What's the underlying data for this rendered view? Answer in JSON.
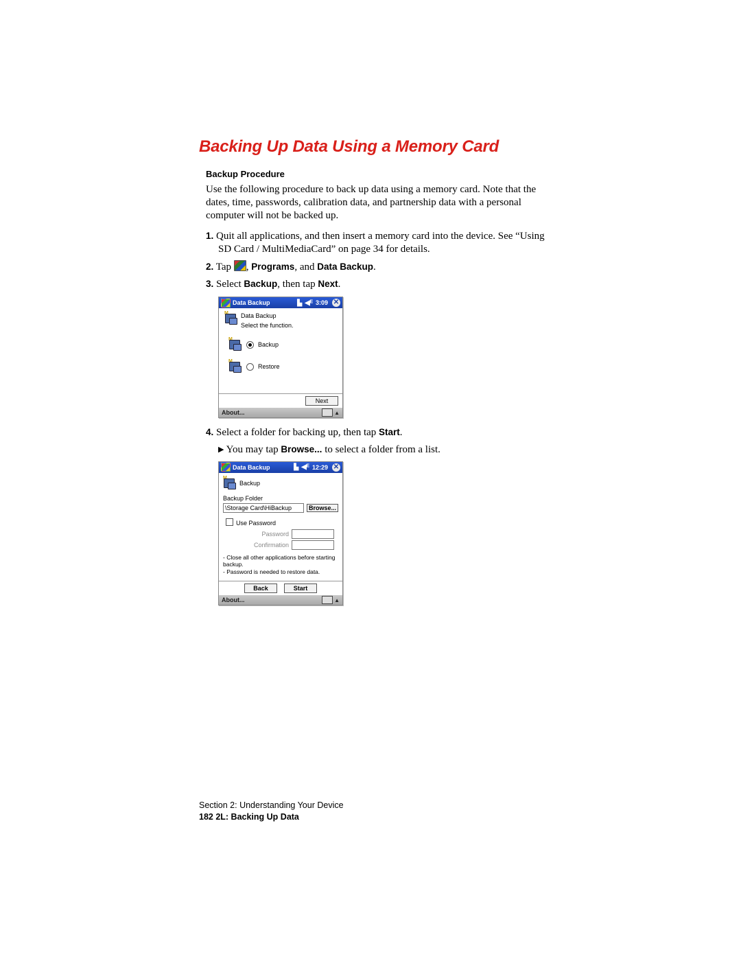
{
  "title": "Backing Up Data Using a Memory Card",
  "sub": "Backup Procedure",
  "intro": "Use the following procedure to back up data using a memory card. Note that the dates, time, passwords, calibration data, and partnership data with a personal computer will not be backed up.",
  "steps": {
    "s1": {
      "num": "1.",
      "a": "Quit all applications, and then insert a memory card into the device. See “Using SD Card / MultiMediaCard” on page 34 for details."
    },
    "s2": {
      "num": "2.",
      "a": "Tap ",
      "b": ", ",
      "c": "Programs",
      "d": ", and ",
      "e": "Data Backup",
      "f": "."
    },
    "s3": {
      "num": "3.",
      "a": "Select ",
      "b": "Backup",
      "c": ", then tap ",
      "d": "Next",
      "e": "."
    },
    "s4": {
      "num": "4.",
      "a": "Select a folder for backing up, then tap ",
      "b": "Start",
      "c": "."
    }
  },
  "note": {
    "pre": "You may tap ",
    "b": "Browse...",
    "post": " to select a folder from a list."
  },
  "shot1": {
    "title": "Data Backup",
    "time": "3:09",
    "hdr_title": "Data Backup",
    "hdr_sub": "Select the function.",
    "opt_backup": "Backup",
    "opt_restore": "Restore",
    "next": "Next",
    "about": "About..."
  },
  "shot2": {
    "title": "Data Backup",
    "time": "12:29",
    "hdr": "Backup",
    "folder_label": "Backup Folder",
    "folder_value": "\\Storage Card\\HiBackup",
    "browse": "Browse...",
    "use_pw": "Use Password",
    "pw": "Password",
    "conf": "Confirmation",
    "note1": "- Close all other applications before starting backup.",
    "note2": "- Password is needed to restore data.",
    "back": "Back",
    "start": "Start",
    "about": "About..."
  },
  "footer": {
    "l1": "Section 2: Understanding Your Device",
    "l2": "182   2L: Backing Up Data"
  }
}
